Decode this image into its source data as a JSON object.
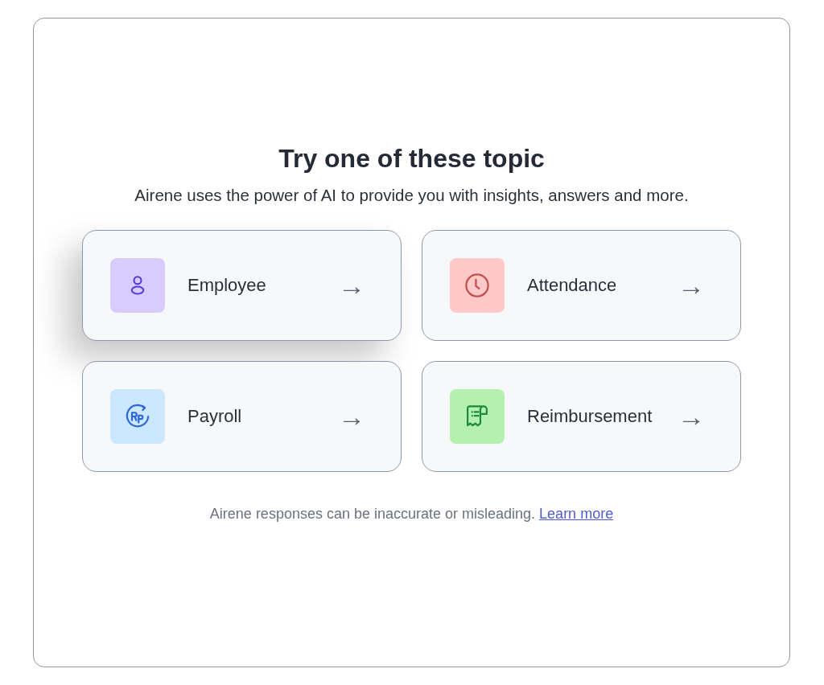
{
  "heading": "Try one of these topic",
  "subtitle": "Airene uses the power of AI to provide you with insights, answers and more.",
  "topics": [
    {
      "kind": "person",
      "label": "Employee",
      "arrow": "→",
      "highlighted": true
    },
    {
      "kind": "clock",
      "label": "Attendance",
      "arrow": "→",
      "highlighted": false
    },
    {
      "kind": "payroll",
      "label": "Payroll",
      "arrow": "→",
      "highlighted": false
    },
    {
      "kind": "receipt",
      "label": "Reimbursement",
      "arrow": "→",
      "highlighted": false
    }
  ],
  "disclaimer": {
    "text": "Airene responses can be inaccurate or misleading.",
    "link": "Learn more"
  }
}
